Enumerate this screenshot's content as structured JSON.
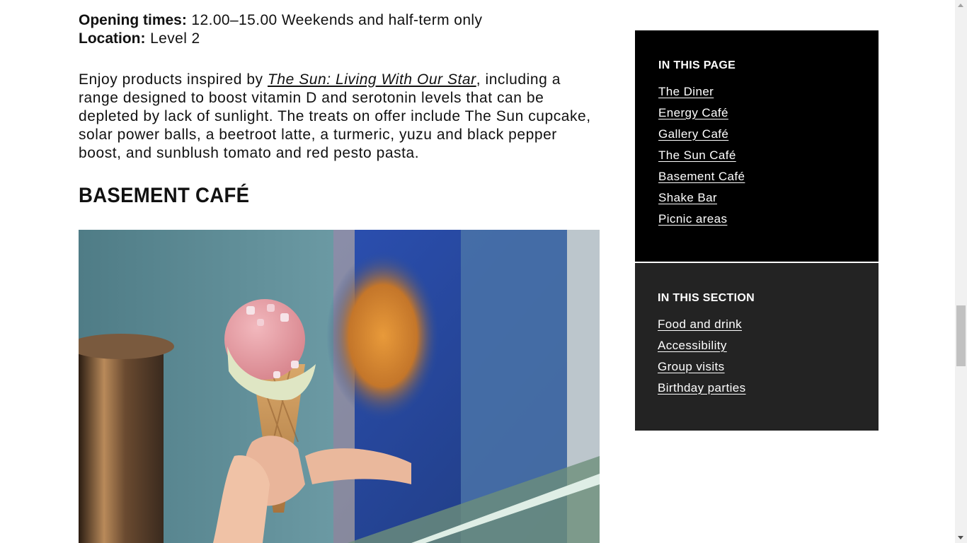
{
  "info": {
    "opening_label": "Opening times:",
    "opening_value": "12.00–15.00 Weekends and half-term only",
    "location_label": "Location:",
    "location_value": "Level 2"
  },
  "description": {
    "before_link": "Enjoy products inspired by ",
    "link_text": "The Sun: Living With Our Star",
    "after_link": ", including a range designed to boost vitamin D and serotonin levels that can be depleted by lack of sunlight. The treats on offer include The Sun cupcake, solar power balls, a beetroot latte, a turmeric, yuzu and black pepper boost, and sunblush tomato and red pesto pasta."
  },
  "section_heading": "BASEMENT CAFÉ",
  "sidebar": {
    "in_this_page": {
      "title": "IN THIS PAGE",
      "links": [
        "The Diner",
        "Energy Café",
        "Gallery Café",
        "The Sun Café",
        "Basement Café",
        "Shake Bar",
        "Picnic areas"
      ]
    },
    "in_this_section": {
      "title": "IN THIS SECTION",
      "links": [
        "Food and drink",
        "Accessibility",
        "Group visits",
        "Birthday parties"
      ]
    }
  },
  "colors": {
    "page_box_bg": "#000000",
    "section_box_bg": "#232323",
    "text": "#111111"
  },
  "icons": {
    "scroll_up": "scroll-up-arrow-icon",
    "scroll_down": "scroll-down-arrow-icon"
  }
}
